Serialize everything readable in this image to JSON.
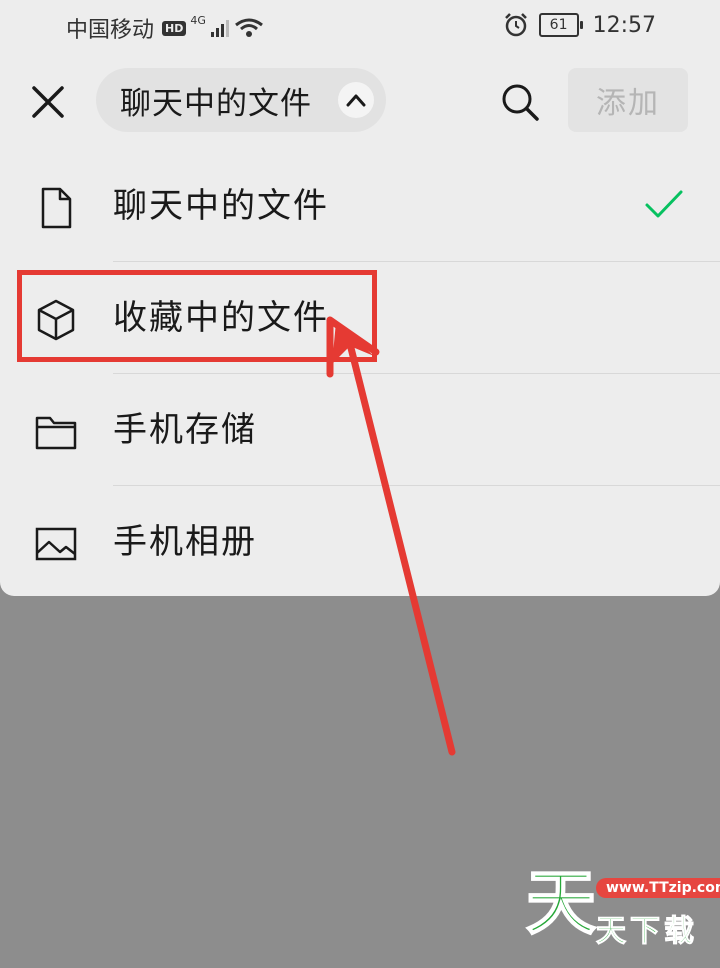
{
  "status_bar": {
    "carrier": "中国移动",
    "hd_badge": "HD",
    "network": "4G",
    "battery": "61",
    "time": "12:57"
  },
  "header": {
    "dropdown_label": "聊天中的文件",
    "add_label": "添加"
  },
  "source_menu": {
    "items": [
      {
        "label": "聊天中的文件",
        "icon": "document-icon",
        "selected": true
      },
      {
        "label": "收藏中的文件",
        "icon": "cube-icon",
        "selected": false
      },
      {
        "label": "手机存储",
        "icon": "folder-icon",
        "selected": false
      },
      {
        "label": "手机相册",
        "icon": "image-icon",
        "selected": false
      }
    ]
  },
  "watermark": {
    "logo_char": "天",
    "url": "www.TTzip.com",
    "brand": "天下载"
  },
  "colors": {
    "accent_check": "#07c160",
    "annotation_red": "#e53a33",
    "sheet_bg": "#ededed",
    "overlay_bg": "#8d8d8d"
  }
}
